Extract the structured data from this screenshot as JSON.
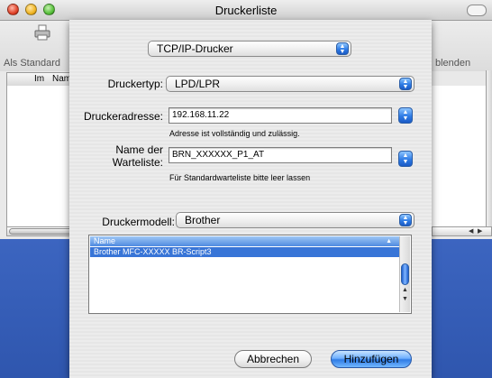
{
  "window": {
    "title": "Druckerliste"
  },
  "toolbar": {
    "left_label": "Als Standard",
    "right_label": "blenden"
  },
  "list": {
    "col_im": "Im",
    "col_name": "Nam"
  },
  "sheet": {
    "protocol_popup": "TCP/IP-Drucker",
    "druckertyp_label": "Druckertyp:",
    "druckertyp_value": "LPD/LPR",
    "druckeradresse_label": "Druckeradresse:",
    "druckeradresse_value": "192.168.11.22",
    "druckeradresse_hint": "Adresse ist vollständig und zulässig.",
    "warteliste_label_1": "Name der",
    "warteliste_label_2": "Warteliste:",
    "warteliste_value": "BRN_XXXXXX_P1_AT",
    "warteliste_hint": "Für Standardwarteliste bitte leer lassen",
    "druckermodell_label": "Druckermodell:",
    "druckermodell_value": "Brother",
    "table_header": "Name",
    "table_rows": [
      "Brother MFC-XXXXX BR-Script3"
    ],
    "cancel_button": "Abbrechen",
    "add_button": "Hinzufügen"
  },
  "colors": {
    "accent": "#3875d7",
    "desktop": "#4a6fc4"
  }
}
